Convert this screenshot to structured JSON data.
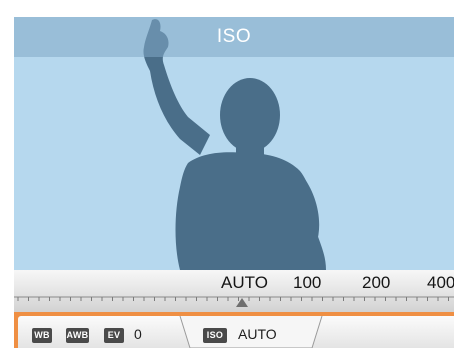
{
  "viewfinder": {
    "title": "ISO"
  },
  "iso_scale": {
    "values": [
      "AUTO",
      "100",
      "200",
      "400"
    ],
    "selected": "AUTO"
  },
  "bottom_bar": {
    "wb_icon": "WB",
    "awb_icon": "AWB",
    "ev_icon": "EV",
    "ev_value": "0",
    "iso_icon": "ISO",
    "iso_value": "AUTO"
  },
  "colors": {
    "sky": "#b6d8ee",
    "title_bar": "#82aac6",
    "silhouette": "#4a6e89",
    "accent_orange": "#ef8f43",
    "scale_bg": "#e6e6e6"
  }
}
